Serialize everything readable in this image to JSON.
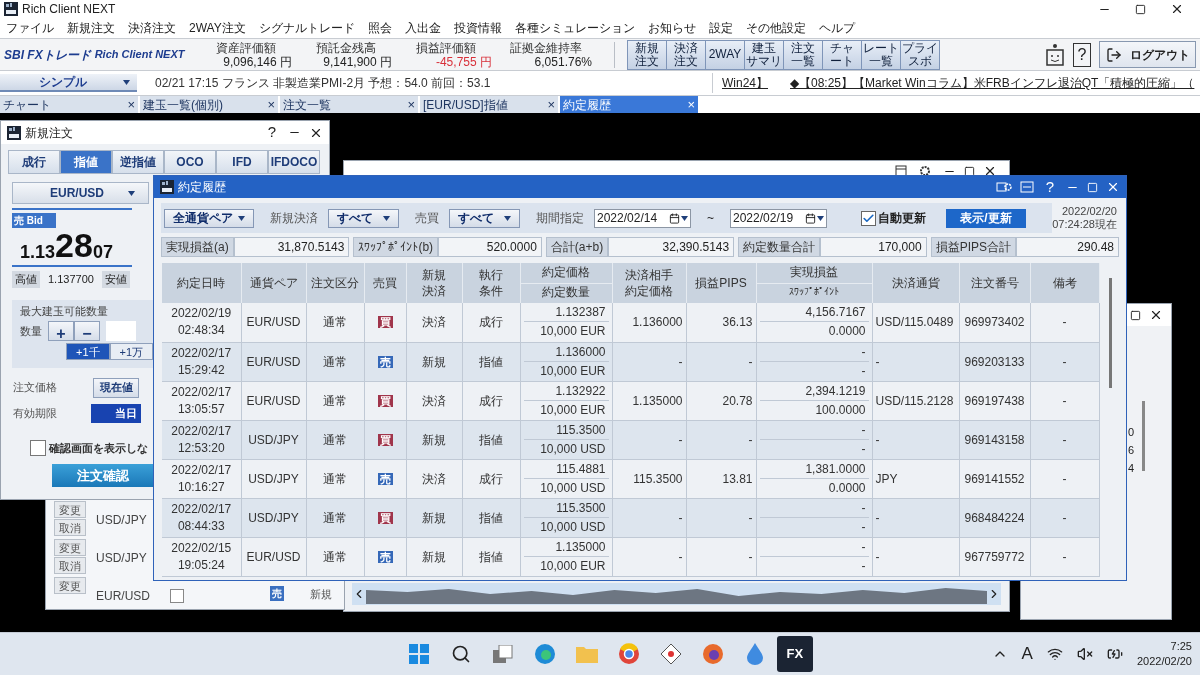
{
  "app": {
    "title": "Rich Client NEXT"
  },
  "menu": [
    "ファイル",
    "新規注文",
    "決済注文",
    "2WAY注文",
    "シグナルトレード",
    "照会",
    "入出金",
    "投資情報",
    "各種シミュレーション",
    "お知らせ",
    "設定",
    "その他設定",
    "ヘルプ"
  ],
  "brand": {
    "company": "SBI FXトレード",
    "product": "Rich Client NEXT"
  },
  "summary": [
    {
      "label": "資産評価額",
      "value": "9,096,146 円",
      "negative": false
    },
    {
      "label": "預託金残高",
      "value": "9,141,900 円",
      "negative": false
    },
    {
      "label": "損益評価額",
      "value": "-45,755 円",
      "negative": true
    },
    {
      "label": "証拠金維持率",
      "value": "6,051.76%",
      "negative": false
    }
  ],
  "quick_buttons": [
    {
      "lines": [
        "新規",
        "注文"
      ]
    },
    {
      "lines": [
        "決済",
        "注文"
      ]
    },
    {
      "lines": [
        "2WAY"
      ]
    },
    {
      "lines": [
        "建玉",
        "サマリ"
      ]
    },
    {
      "lines": [
        "注文",
        "一覧"
      ]
    },
    {
      "lines": [
        "チャ",
        "ート"
      ]
    },
    {
      "lines": [
        "レート",
        "一覧"
      ]
    },
    {
      "lines": [
        "プライ",
        "スボ"
      ]
    }
  ],
  "help": "?",
  "logout": "ログアウト",
  "mode_select": "シンプル",
  "news": [
    "02/21 17:15 フランス 非製造業PMI-2月 予想：54.0 前回：53.1",
    "Win24】",
    "◆【08:25】【Market Winコラム】米FRBインフレ退治QT「積極的圧縮」（"
  ],
  "tabs": [
    {
      "label": "チャート",
      "selected": false
    },
    {
      "label": "建玉一覧(個別)",
      "selected": false
    },
    {
      "label": "注文一覧",
      "selected": false
    },
    {
      "label": "[EUR/USD]指値",
      "selected": false
    },
    {
      "label": "約定履歴",
      "selected": true
    }
  ],
  "tab_close": "×",
  "order_window": {
    "title": "新規注文",
    "help": "?",
    "tabs": [
      {
        "label": "成行",
        "selected": false
      },
      {
        "label": "指値",
        "selected": true
      },
      {
        "label": "逆指値",
        "selected": false
      },
      {
        "label": "OCO",
        "selected": false
      },
      {
        "label": "IFD",
        "selected": false
      },
      {
        "label": "IFDOCO",
        "selected": false
      }
    ],
    "pair": "EUR/USD",
    "side_label": "売 Bid",
    "price_head": "1.13",
    "price_big": "28",
    "price_tail": "07",
    "high_label": "高値",
    "high": "1.137700",
    "low_label": "安値",
    "max_label": "最大建玉可能数量",
    "qty_label": "数量",
    "plus": "+",
    "minus": "−",
    "steps": [
      {
        "label": "+1千",
        "selected": true
      },
      {
        "label": "+1万",
        "selected": false
      }
    ],
    "price_label": "注文価格",
    "price_button": "現在値",
    "expiry_label": "有効期限",
    "expiry_button": "当日",
    "confirm_checked": false,
    "confirm_label": "確認画面を表示しな",
    "submit": "注文確認"
  },
  "order_list_window": {
    "rows": [
      {
        "change": "変更",
        "cancel": "取消",
        "pair": "USD/JPY"
      },
      {
        "change": "変更",
        "cancel": "取消",
        "pair": "USD/JPY"
      },
      {
        "change": "変更",
        "pair": "EUR/USD"
      }
    ],
    "last_checked": false,
    "last_side": "売",
    "last_type": "新規"
  },
  "side_window": {
    "values": [
      "0",
      "6",
      "4"
    ]
  },
  "history_window": {
    "title": "約定履歴",
    "help": "?",
    "filters": {
      "pair": "全通貨ペア",
      "open_close_label": "新規決済",
      "open_close": "すべて",
      "side_label": "売買",
      "side": "すべて",
      "period_label": "期間指定",
      "from": "2022/02/14",
      "tilde": "~",
      "to": "2022/02/19",
      "auto_label": "自動更新",
      "auto_checked": true,
      "refresh": "表示/更新",
      "stamp": "2022/02/20\n07:24:28現在"
    },
    "totals": [
      {
        "label": "実現損益(a)",
        "value": "31,870.5143"
      },
      {
        "label": "ｽﾜｯﾌﾟﾎﾟｲﾝﾄ(b)",
        "value": "520.0000"
      },
      {
        "label": "合計(a+b)",
        "value": "32,390.5143"
      },
      {
        "label": "約定数量合計",
        "value": "170,000"
      },
      {
        "label": "損益PIPS合計",
        "value": "290.48"
      }
    ],
    "columns": [
      {
        "kind": "single",
        "lines": [
          "約定日時"
        ]
      },
      {
        "kind": "single",
        "lines": [
          "通貨ペア"
        ]
      },
      {
        "kind": "single",
        "lines": [
          "注文区分"
        ]
      },
      {
        "kind": "single",
        "lines": [
          "売買"
        ]
      },
      {
        "kind": "stacked",
        "lines": [
          "新規",
          "決済"
        ]
      },
      {
        "kind": "stacked",
        "lines": [
          "執行",
          "条件"
        ]
      },
      {
        "kind": "split",
        "lines": [
          "約定価格",
          "約定数量"
        ]
      },
      {
        "kind": "stacked",
        "lines": [
          "決済相手",
          "約定価格"
        ]
      },
      {
        "kind": "single",
        "lines": [
          "損益PIPS"
        ]
      },
      {
        "kind": "split",
        "lines": [
          "実現損益",
          "ｽﾜｯﾌﾟﾎﾟｲﾝﾄ"
        ]
      },
      {
        "kind": "single",
        "lines": [
          "決済通貨"
        ]
      },
      {
        "kind": "single",
        "lines": [
          "注文番号"
        ]
      },
      {
        "kind": "single",
        "lines": [
          "備考"
        ]
      }
    ],
    "rows": [
      {
        "datetime": "2022/02/19\n02:48:34",
        "pair": "EUR/USD",
        "order_type": "通常",
        "side": {
          "label": "買",
          "kind": "buy"
        },
        "open_close": "決済",
        "condition": "成行",
        "price": "1.132387",
        "quantity": "10,000 EUR",
        "counter_price": "1.136000",
        "pips": "36.13",
        "pnl": "4,156.7167",
        "swap": "0.0000",
        "settle": "USD/115.0489",
        "order_no": "969973402",
        "note": "-"
      },
      {
        "datetime": "2022/02/17\n15:29:42",
        "pair": "EUR/USD",
        "order_type": "通常",
        "side": {
          "label": "売",
          "kind": "sell"
        },
        "open_close": "新規",
        "condition": "指値",
        "price": "1.136000",
        "quantity": "10,000 EUR",
        "counter_price": "-",
        "pips": "-",
        "pnl": "-",
        "swap": "-",
        "settle": "-",
        "order_no": "969203133",
        "note": "-"
      },
      {
        "datetime": "2022/02/17\n13:05:57",
        "pair": "EUR/USD",
        "order_type": "通常",
        "side": {
          "label": "買",
          "kind": "buy"
        },
        "open_close": "決済",
        "condition": "成行",
        "price": "1.132922",
        "quantity": "10,000 EUR",
        "counter_price": "1.135000",
        "pips": "20.78",
        "pnl": "2,394.1219",
        "swap": "100.0000",
        "settle": "USD/115.2128",
        "order_no": "969197438",
        "note": "-"
      },
      {
        "datetime": "2022/02/17\n12:53:20",
        "pair": "USD/JPY",
        "order_type": "通常",
        "side": {
          "label": "買",
          "kind": "buy"
        },
        "open_close": "新規",
        "condition": "指値",
        "price": "115.3500",
        "quantity": "10,000 USD",
        "counter_price": "-",
        "pips": "-",
        "pnl": "-",
        "swap": "-",
        "settle": "-",
        "order_no": "969143158",
        "note": "-"
      },
      {
        "datetime": "2022/02/17\n10:16:27",
        "pair": "USD/JPY",
        "order_type": "通常",
        "side": {
          "label": "売",
          "kind": "sell"
        },
        "open_close": "決済",
        "condition": "成行",
        "price": "115.4881",
        "quantity": "10,000 USD",
        "counter_price": "115.3500",
        "pips": "13.81",
        "pnl": "1,381.0000",
        "swap": "0.0000",
        "settle": "JPY",
        "order_no": "969141552",
        "note": "-"
      },
      {
        "datetime": "2022/02/17\n08:44:33",
        "pair": "USD/JPY",
        "order_type": "通常",
        "side": {
          "label": "買",
          "kind": "buy"
        },
        "open_close": "新規",
        "condition": "指値",
        "price": "115.3500",
        "quantity": "10,000 USD",
        "counter_price": "-",
        "pips": "-",
        "pnl": "-",
        "swap": "-",
        "settle": "-",
        "order_no": "968484224",
        "note": "-"
      },
      {
        "datetime": "2022/02/15\n19:05:24",
        "pair": "EUR/USD",
        "order_type": "通常",
        "side": {
          "label": "売",
          "kind": "sell"
        },
        "open_close": "新規",
        "condition": "指値",
        "price": "1.135000",
        "quantity": "10,000 EUR",
        "counter_price": "-",
        "pips": "-",
        "pnl": "-",
        "swap": "-",
        "settle": "-",
        "order_no": "967759772",
        "note": "-"
      }
    ]
  },
  "taskbar": {
    "app_label": "FX",
    "ime": "A",
    "time": "7:25",
    "date": "2022/02/20"
  }
}
